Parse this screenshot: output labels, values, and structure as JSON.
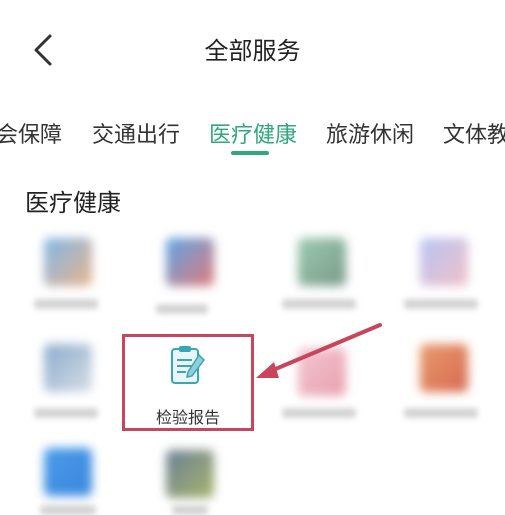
{
  "header": {
    "title": "全部服务"
  },
  "tabs": [
    {
      "label": "会保障",
      "active": false
    },
    {
      "label": "交通出行",
      "active": false
    },
    {
      "label": "医疗健康",
      "active": true
    },
    {
      "label": "旅游休闲",
      "active": false
    },
    {
      "label": "文体教",
      "active": false
    }
  ],
  "section": {
    "title": "医疗健康"
  },
  "highlighted_service": {
    "label": "检验报告",
    "icon": "clipboard-pen-icon"
  },
  "colors": {
    "accent": "#2fa87c",
    "highlight": "#c8465c"
  }
}
